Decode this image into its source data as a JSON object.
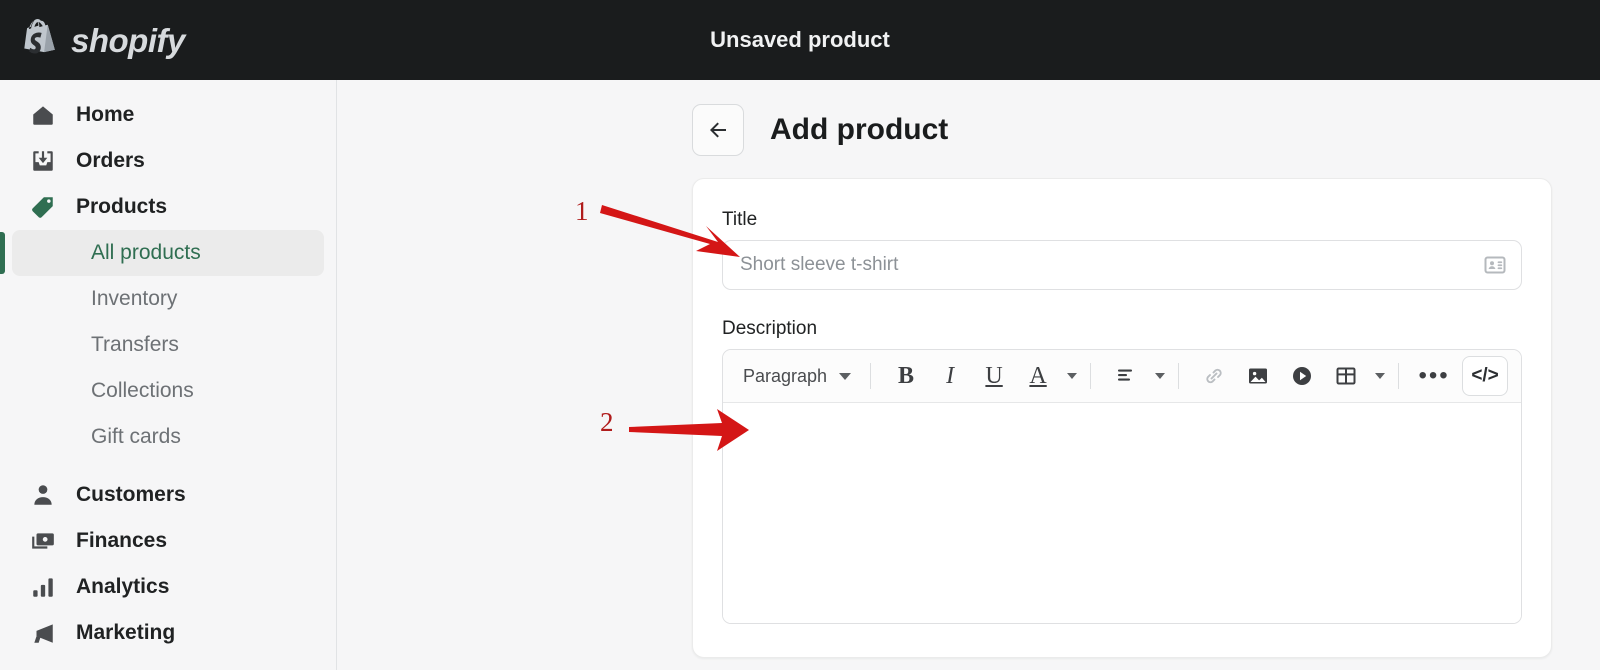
{
  "topbar": {
    "brand": "shopify",
    "logo_icon": "shopify-bag-icon",
    "title": "Unsaved product"
  },
  "sidebar": {
    "items": [
      {
        "label": "Home",
        "icon": "home-icon",
        "type": "main"
      },
      {
        "label": "Orders",
        "icon": "orders-inbox-icon",
        "type": "main"
      },
      {
        "label": "Products",
        "icon": "products-tag-icon",
        "type": "main"
      },
      {
        "label": "All products",
        "type": "sub",
        "active": true
      },
      {
        "label": "Inventory",
        "type": "sub",
        "active": false
      },
      {
        "label": "Transfers",
        "type": "sub",
        "active": false
      },
      {
        "label": "Collections",
        "type": "sub",
        "active": false
      },
      {
        "label": "Gift cards",
        "type": "sub",
        "active": false
      },
      {
        "label": "Customers",
        "icon": "customers-person-icon",
        "type": "main"
      },
      {
        "label": "Finances",
        "icon": "finances-cash-icon",
        "type": "main"
      },
      {
        "label": "Analytics",
        "icon": "analytics-bars-icon",
        "type": "main"
      },
      {
        "label": "Marketing",
        "icon": "marketing-megaphone-icon",
        "type": "main"
      }
    ],
    "active_color": "#2f6e51",
    "active_bg": "#ebebeb"
  },
  "page": {
    "back_icon": "arrow-left-icon",
    "title": "Add product"
  },
  "form": {
    "title_label": "Title",
    "title_value": "",
    "title_placeholder": "Short sleeve t-shirt",
    "title_trailing_icon": "contact-card-icon",
    "description_label": "Description",
    "description_value": ""
  },
  "toolbar": {
    "block_format": "Paragraph",
    "buttons": [
      {
        "name": "bold-button",
        "label": "B"
      },
      {
        "name": "italic-button",
        "label": "I"
      },
      {
        "name": "underline-button",
        "label": "U"
      },
      {
        "name": "text-color-button",
        "label": "A"
      },
      {
        "name": "align-button",
        "label": "align-left-icon"
      },
      {
        "name": "link-button",
        "label": "link-icon",
        "disabled": true
      },
      {
        "name": "image-button",
        "label": "image-icon"
      },
      {
        "name": "video-button",
        "label": "video-play-icon"
      },
      {
        "name": "table-button",
        "label": "table-icon"
      },
      {
        "name": "more-button",
        "label": "•••"
      },
      {
        "name": "code-button",
        "label": "</>"
      }
    ],
    "more_label": "•••",
    "code_label": "</>"
  },
  "annotations": [
    {
      "number": "1",
      "target": "title-input",
      "color": "#b01c1c"
    },
    {
      "number": "2",
      "target": "description-editor-body",
      "color": "#b01c1c"
    }
  ]
}
